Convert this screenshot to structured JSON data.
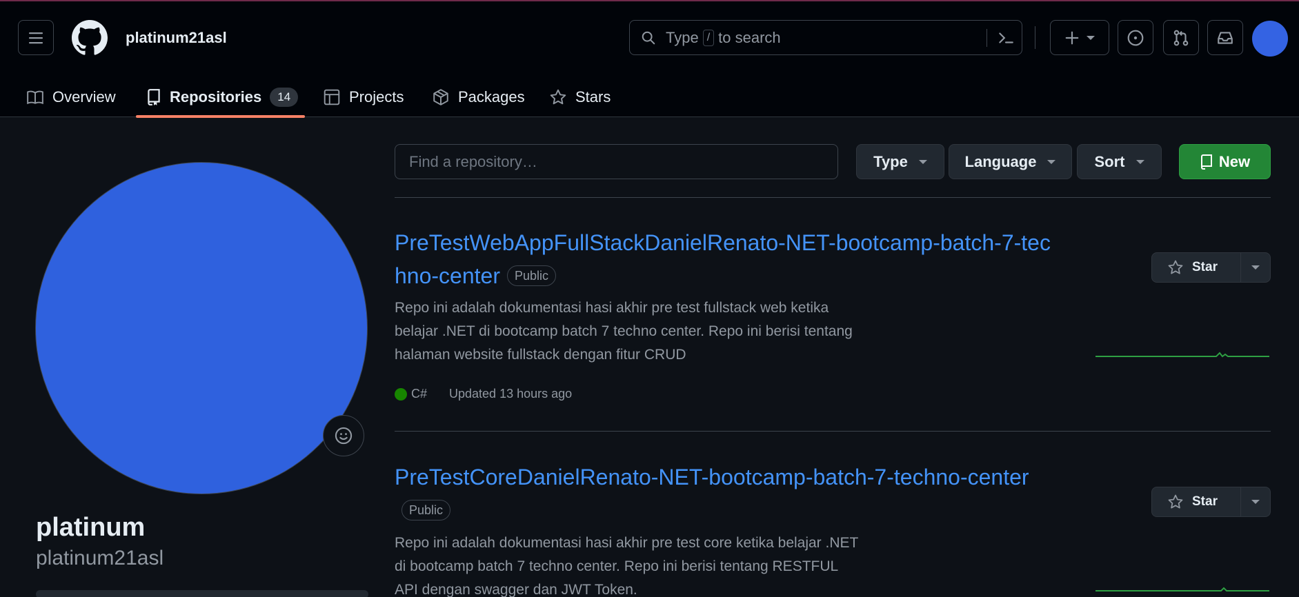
{
  "header": {
    "username": "platinum21asl",
    "search": {
      "prefix": "Type",
      "key": "/",
      "suffix": "to search"
    },
    "icons": [
      "hamburger-icon",
      "github-logo-icon",
      "search-icon",
      "command-palette-icon",
      "plus-icon",
      "issue-icon",
      "pull-request-icon",
      "inbox-icon"
    ]
  },
  "tabs": [
    {
      "label": "Overview",
      "icon": "book-icon"
    },
    {
      "label": "Repositories",
      "icon": "repo-icon",
      "count": "14",
      "active": true
    },
    {
      "label": "Projects",
      "icon": "table-icon"
    },
    {
      "label": "Packages",
      "icon": "package-icon"
    },
    {
      "label": "Stars",
      "icon": "star-icon"
    }
  ],
  "profile": {
    "name": "platinum",
    "login": "platinum21asl",
    "avatar_color": "#2f61de"
  },
  "filters": {
    "find_placeholder": "Find a repository…",
    "type_label": "Type",
    "language_label": "Language",
    "sort_label": "Sort",
    "new_label": "New"
  },
  "repos": [
    {
      "name": "PreTestWebAppFullStackDanielRenato-NET-bootcamp-batch-7-techno-center",
      "visibility": "Public",
      "description": "Repo ini adalah dokumentasi hasi akhir pre test fullstack web ketika belajar .NET di bootcamp batch 7 techno center. Repo ini berisi tentang halaman website fullstack dengan fitur CRUD",
      "language": "C#",
      "language_color": "#178600",
      "updated": "Updated 13 hours ago",
      "star_label": "Star"
    },
    {
      "name": "PreTestCoreDanielRenato-NET-bootcamp-batch-7-techno-center",
      "visibility": "Public",
      "description": "Repo ini adalah dokumentasi hasi akhir pre test core ketika belajar .NET di bootcamp batch 7 techno center. Repo ini berisi tentang RESTFUL API dengan swagger dan JWT Token.",
      "star_label": "Star"
    }
  ],
  "colors": {
    "background": "#0d1117",
    "header_bg": "#010409",
    "link": "#4493f8",
    "accent_underline": "#f78166",
    "new_button": "#238636",
    "sparkline": "#2ea043"
  }
}
